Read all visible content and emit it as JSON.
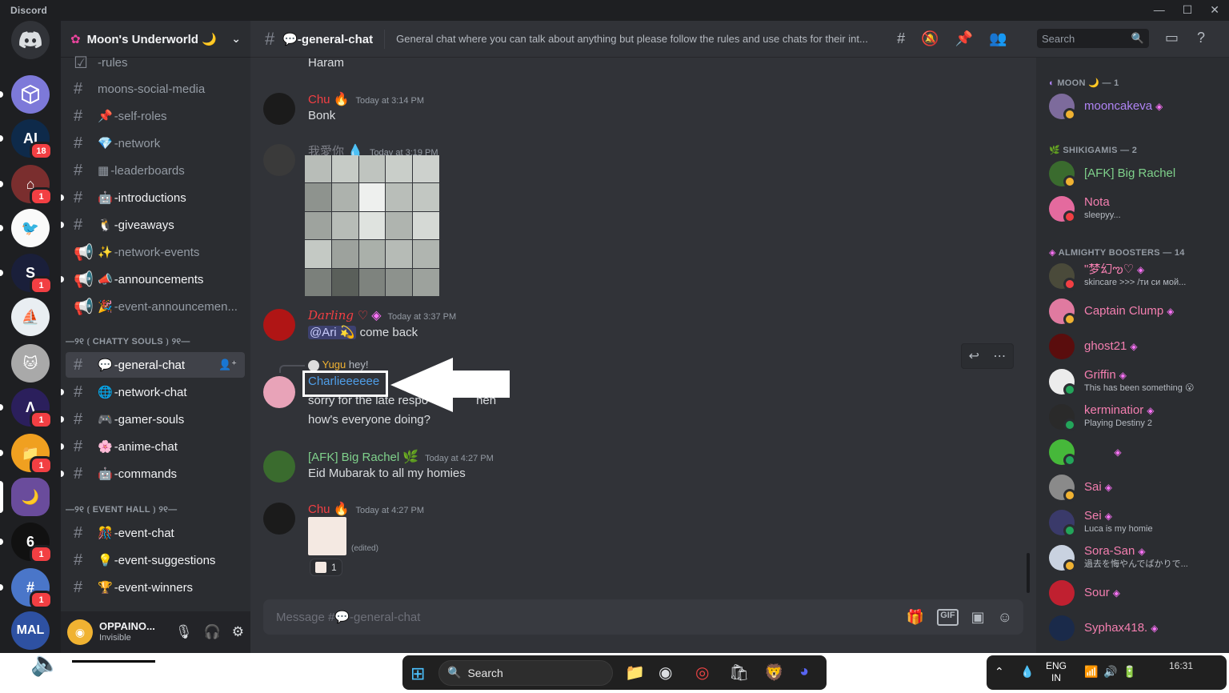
{
  "app": {
    "title": "Discord"
  },
  "server": {
    "name": "Moon's Underworld 🌙"
  },
  "rail": {
    "badges": {
      "ai": "18",
      "s2": "1",
      "s3": "1",
      "s5": "1",
      "s6": "1",
      "s7": "1",
      "s8": "1",
      "s9": "1"
    },
    "mal_label": "MAL"
  },
  "channels": {
    "c1": "-rules",
    "c2": "moons-social-media",
    "c3": "-self-roles",
    "c4": "-network",
    "c5": "-leaderboards",
    "c6": "-introductions",
    "c7": "-giveaways",
    "c8": "-network-events",
    "c9": "-announcements",
    "c10": "-event-announcemen...",
    "cat1": "—୨୧ ⟮ CHATTY SOULS ⟯ ୨୧—",
    "c11": "-general-chat",
    "c12": "-network-chat",
    "c13": "-gamer-souls",
    "c14": "-anime-chat",
    "c15": "-commands",
    "cat2": "—୨୧ ⟮ EVENT HALL ⟯ ୨୧—",
    "c16": "-event-chat",
    "c17": "-event-suggestions",
    "c18": "-event-winners"
  },
  "user": {
    "name": "OPPAINO...",
    "status": "Invisible"
  },
  "header": {
    "channel": "💬-general-chat",
    "topic": "General chat where you can talk about anything but please follow the rules and use chats for their int...",
    "search_placeholder": "Search"
  },
  "messages": {
    "m0_body": "Haram",
    "m1_author": "Chu",
    "m1_time": "Today at 3:14 PM",
    "m1_body": "Bonk",
    "m2_author": "我愛你",
    "m2_time": "Today at 3:19 PM",
    "m3_author": "Darling ♡",
    "m3_time": "Today at 3:37 PM",
    "m3_mention": "@Ari 💫",
    "m3_body": "come back",
    "m4_reply_author": "Yugu",
    "m4_reply_text": "hey!",
    "m4_author": "Charlieeeeee",
    "m4_body1": "sorry for the late respo",
    "m4_body1_tail": "heh",
    "m4_body2": "how's everyone doing?",
    "m5_author": "[AFK] Big Rachel",
    "m5_time": "Today at 4:27 PM",
    "m5_body": "Eid Mubarak to all my homies",
    "m6_author": "Chu",
    "m6_time": "Today at 4:27 PM",
    "m6_edited": "(edited)",
    "m6_reaction_count": "1"
  },
  "composer": {
    "placeholder": "Message #💬-general-chat",
    "gif": "GIF"
  },
  "members": {
    "cat_moon": "MOON 🌙 — 1",
    "moon1": "mooncakeva",
    "cat_shiki": "SHIKIGAMIS — 2",
    "shiki1": "[AFK] Big Rachel",
    "shiki2": "Nota",
    "shiki2_sub": "sleepyy...",
    "cat_boost": "ALMIGHTY BOOSTERS — 14",
    "b1": "\"梦幻ఌ♡",
    "b1_sub": "skincare >>> /ти си мой...",
    "b2": "Captain Clump",
    "b3": "ghost21",
    "b4": "Griffin",
    "b4_sub": "This has been something 😮",
    "b5": "kerminatior",
    "b5_sub": "Playing Destiny 2",
    "b6": "Sai",
    "b7": "Sei",
    "b7_sub": "Luca is my homie",
    "b8": "Sora-San",
    "b8_sub": "過去を悔やんでばかりで...",
    "b9": "Sour",
    "b10": "Syphax418."
  },
  "taskbar": {
    "search": "Search",
    "lang1": "ENG",
    "lang2": "IN",
    "time": "16:31"
  },
  "colors": {
    "accent": "#5865f2",
    "pink": "#f23f43",
    "green": "#23a55a"
  }
}
